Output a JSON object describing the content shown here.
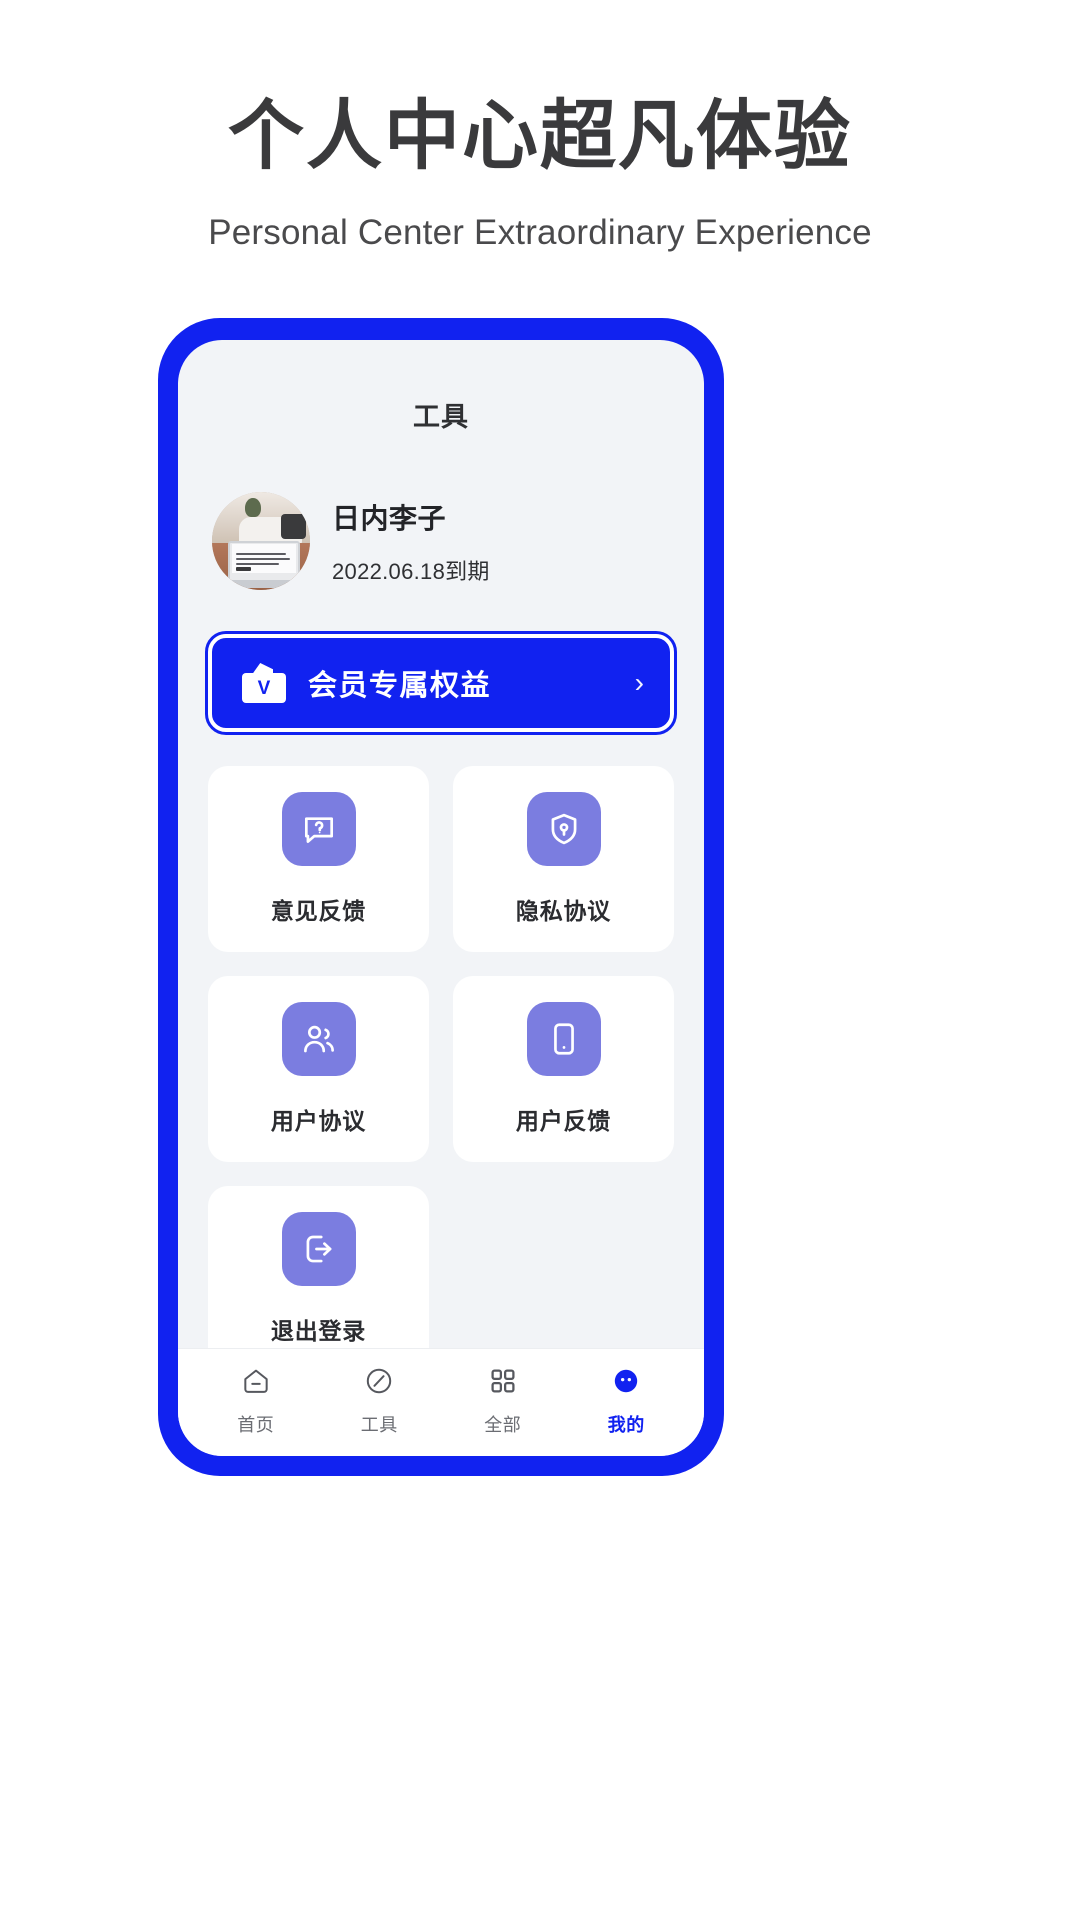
{
  "promo": {
    "title": "个人中心超凡体验",
    "subtitle": "Personal Center Extraordinary Experience",
    "title_color": "#3a3a3c",
    "frame_color": "#1122F0",
    "screen_bg": "#F2F4F7",
    "accent_color": "#1122F0",
    "icon_badge_color": "#7B7DE0"
  },
  "screen": {
    "title": "工具",
    "profile": {
      "name": "日内李子",
      "expiry": "2022.06.18到期",
      "avatar_icon": "photo-avatar"
    },
    "vip_banner": {
      "label": "会员专属权益",
      "icon": "vip-card-icon",
      "chevron": "›"
    },
    "tiles": [
      {
        "label": "意见反馈",
        "icon": "question-chat-icon"
      },
      {
        "label": "隐私协议",
        "icon": "shield-location-icon"
      },
      {
        "label": "用户协议",
        "icon": "users-icon"
      },
      {
        "label": "用户反馈",
        "icon": "mobile-device-icon"
      },
      {
        "label": "退出登录",
        "icon": "logout-icon"
      }
    ],
    "tabs": [
      {
        "label": "首页",
        "icon": "home-icon",
        "active": false
      },
      {
        "label": "工具",
        "icon": "tools-circle-icon",
        "active": false
      },
      {
        "label": "全部",
        "icon": "grid-squares-icon",
        "active": false
      },
      {
        "label": "我的",
        "icon": "profile-filled-icon",
        "active": true
      }
    ]
  }
}
